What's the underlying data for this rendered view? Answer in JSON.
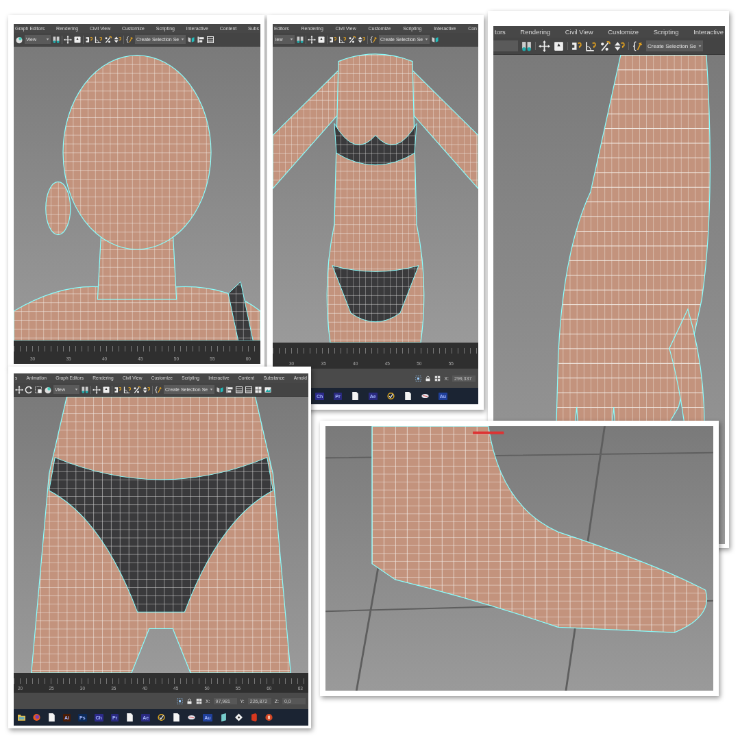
{
  "panels": [
    {
      "menu": [
        "Graph Editors",
        "Rendering",
        "Civil View",
        "Customize",
        "Scripting",
        "Interactive",
        "Content",
        "Subs"
      ],
      "view_dropdown": "View",
      "selection_set": "Create Selection Se",
      "timeline_ticks": [
        "30",
        "35",
        "40",
        "45",
        "50",
        "55",
        "60"
      ]
    },
    {
      "menu": [
        "Editors",
        "Rendering",
        "Civil View",
        "Customize",
        "Scripting",
        "Interactive",
        "Con"
      ],
      "view_dropdown": "iew",
      "selection_set": "Create Selection Se",
      "timeline_ticks": [
        "30",
        "35",
        "40",
        "45",
        "50",
        "55"
      ],
      "coordinates": [
        {
          "label": "X:",
          "value": "299,337"
        }
      ],
      "taskbar": [
        {
          "kind": "app",
          "label": "Ch",
          "color": "#2c2a8a"
        },
        {
          "kind": "app",
          "label": "Pr",
          "color": "#2a2a80"
        },
        {
          "kind": "doc"
        },
        {
          "kind": "app",
          "label": "Ae",
          "color": "#2a2a80"
        },
        {
          "kind": "check"
        },
        {
          "kind": "doc"
        },
        {
          "kind": "disk"
        },
        {
          "kind": "app",
          "label": "Au",
          "color": "#1f3f9a"
        }
      ]
    },
    {
      "menu": [
        "tors",
        "Rendering",
        "Civil View",
        "Customize",
        "Scripting",
        "Interactive"
      ],
      "selection_set": "Create Selection Se"
    },
    {
      "menu": [
        "s",
        "Animation",
        "Graph Editors",
        "Rendering",
        "Civil View",
        "Customize",
        "Scripting",
        "Interactive",
        "Content",
        "Substance",
        "Arnold"
      ],
      "view_dropdown": "View",
      "selection_set": "Create Selection Se",
      "timeline_ticks": [
        "20",
        "25",
        "30",
        "35",
        "40",
        "45",
        "50",
        "55",
        "60",
        "63"
      ],
      "coordinates": [
        {
          "label": "X:",
          "value": "97,981"
        },
        {
          "label": "Y:",
          "value": "226,872"
        },
        {
          "label": "Z:",
          "value": "0,0"
        }
      ],
      "taskbar": [
        {
          "kind": "folder"
        },
        {
          "kind": "globe"
        },
        {
          "kind": "doc"
        },
        {
          "kind": "app",
          "label": "Ai",
          "color": "#4a1c05"
        },
        {
          "kind": "app",
          "label": "Ps",
          "color": "#0b2a5a"
        },
        {
          "kind": "app",
          "label": "Ch",
          "color": "#2c2a8a"
        },
        {
          "kind": "app",
          "label": "Pr",
          "color": "#2a2a80"
        },
        {
          "kind": "doc"
        },
        {
          "kind": "app",
          "label": "Ae",
          "color": "#2a2a80"
        },
        {
          "kind": "check"
        },
        {
          "kind": "doc"
        },
        {
          "kind": "disk"
        },
        {
          "kind": "app",
          "label": "Au",
          "color": "#1f3f9a"
        },
        {
          "kind": "tile"
        },
        {
          "kind": "diamond"
        },
        {
          "kind": "block"
        },
        {
          "kind": "circle"
        }
      ]
    },
    {
      "viewport": {
        "kind": "picture"
      }
    }
  ]
}
